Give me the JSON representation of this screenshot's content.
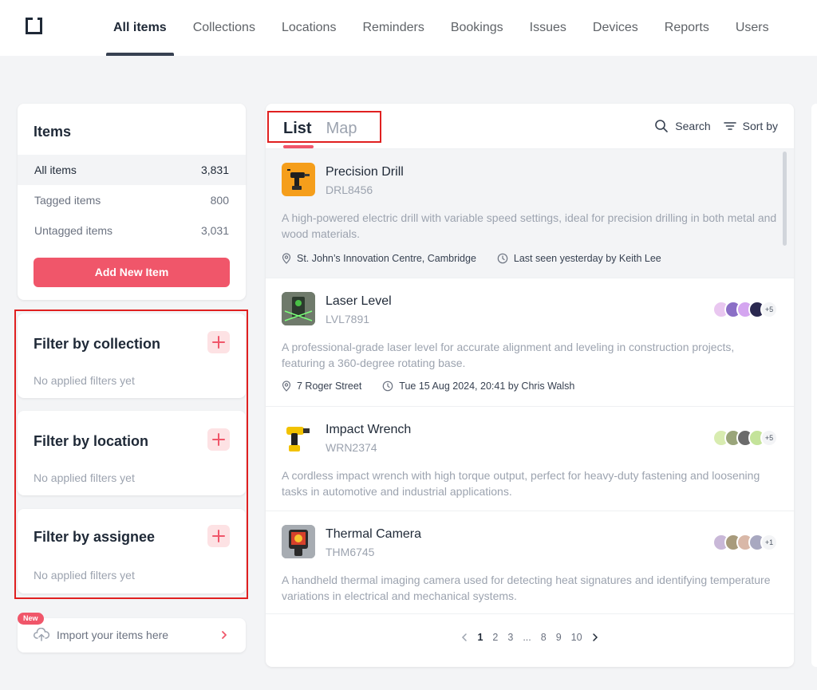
{
  "nav": {
    "items": [
      "All items",
      "Collections",
      "Locations",
      "Reminders",
      "Bookings",
      "Issues",
      "Devices",
      "Reports",
      "Users"
    ],
    "active": "All items"
  },
  "sidebar": {
    "title": "Items",
    "rows": [
      {
        "label": "All items",
        "count": "3,831"
      },
      {
        "label": "Tagged items",
        "count": "800"
      },
      {
        "label": "Untagged items",
        "count": "3,031"
      }
    ],
    "add_label": "Add New Item",
    "filters": [
      {
        "title": "Filter by collection",
        "empty": "No applied filters yet"
      },
      {
        "title": "Filter by location",
        "empty": "No applied filters yet"
      },
      {
        "title": "Filter by assignee",
        "empty": "No applied filters yet"
      }
    ],
    "import": {
      "badge": "New",
      "label": "Import your items here"
    }
  },
  "main": {
    "tabs": [
      "List",
      "Map"
    ],
    "search_label": "Search",
    "sort_label": "Sort by",
    "items": [
      {
        "name": "Precision Drill",
        "code": "DRL8456",
        "desc": "A high-powered electric drill with variable speed settings, ideal for precision drilling in both metal and wood materials.",
        "location": "St. John’s Innovation Centre, Cambridge",
        "seen": "Last seen yesterday by Keith Lee",
        "thumb_icon": "drill-icon",
        "avatars": [],
        "more": ""
      },
      {
        "name": "Laser Level",
        "code": "LVL7891",
        "desc": "A professional-grade laser level for accurate alignment and leveling in construction projects, featuring a 360-degree rotating base.",
        "location": "7 Roger Street",
        "seen": "Tue 15 Aug 2024, 20:41 by Chris Walsh",
        "thumb_icon": "laser-level-icon",
        "avatars": [
          "#e9c7f0",
          "#8b6fc6",
          "#d4a5f0",
          "#2b2950"
        ],
        "more": "+5"
      },
      {
        "name": "Impact Wrench",
        "code": "WRN2374",
        "desc": "A cordless impact wrench with high torque output, perfect for heavy-duty fastening and loosening tasks in automotive and industrial applications.",
        "location": "",
        "seen": "",
        "thumb_icon": "wrench-icon",
        "avatars": [
          "#d8ecb0",
          "#9aa57a",
          "#6b6b6b",
          "#c4e39a"
        ],
        "more": "+5"
      },
      {
        "name": "Thermal Camera",
        "code": "THM6745",
        "desc": "A handheld thermal imaging camera used for detecting heat signatures and identifying temperature variations in electrical and mechanical systems.",
        "location": "",
        "seen": "",
        "thumb_icon": "thermal-camera-icon",
        "avatars": [
          "#c9b8d8",
          "#a89b7c",
          "#d9b8a8",
          "#a8a8c0"
        ],
        "more": "+1"
      }
    ],
    "pager": [
      "1",
      "2",
      "3",
      "...",
      "8",
      "9",
      "10"
    ],
    "current_page": "1"
  },
  "colors": {
    "accent": "#f0566a",
    "accent_soft": "#fde2e4",
    "annotation": "#e02020"
  }
}
